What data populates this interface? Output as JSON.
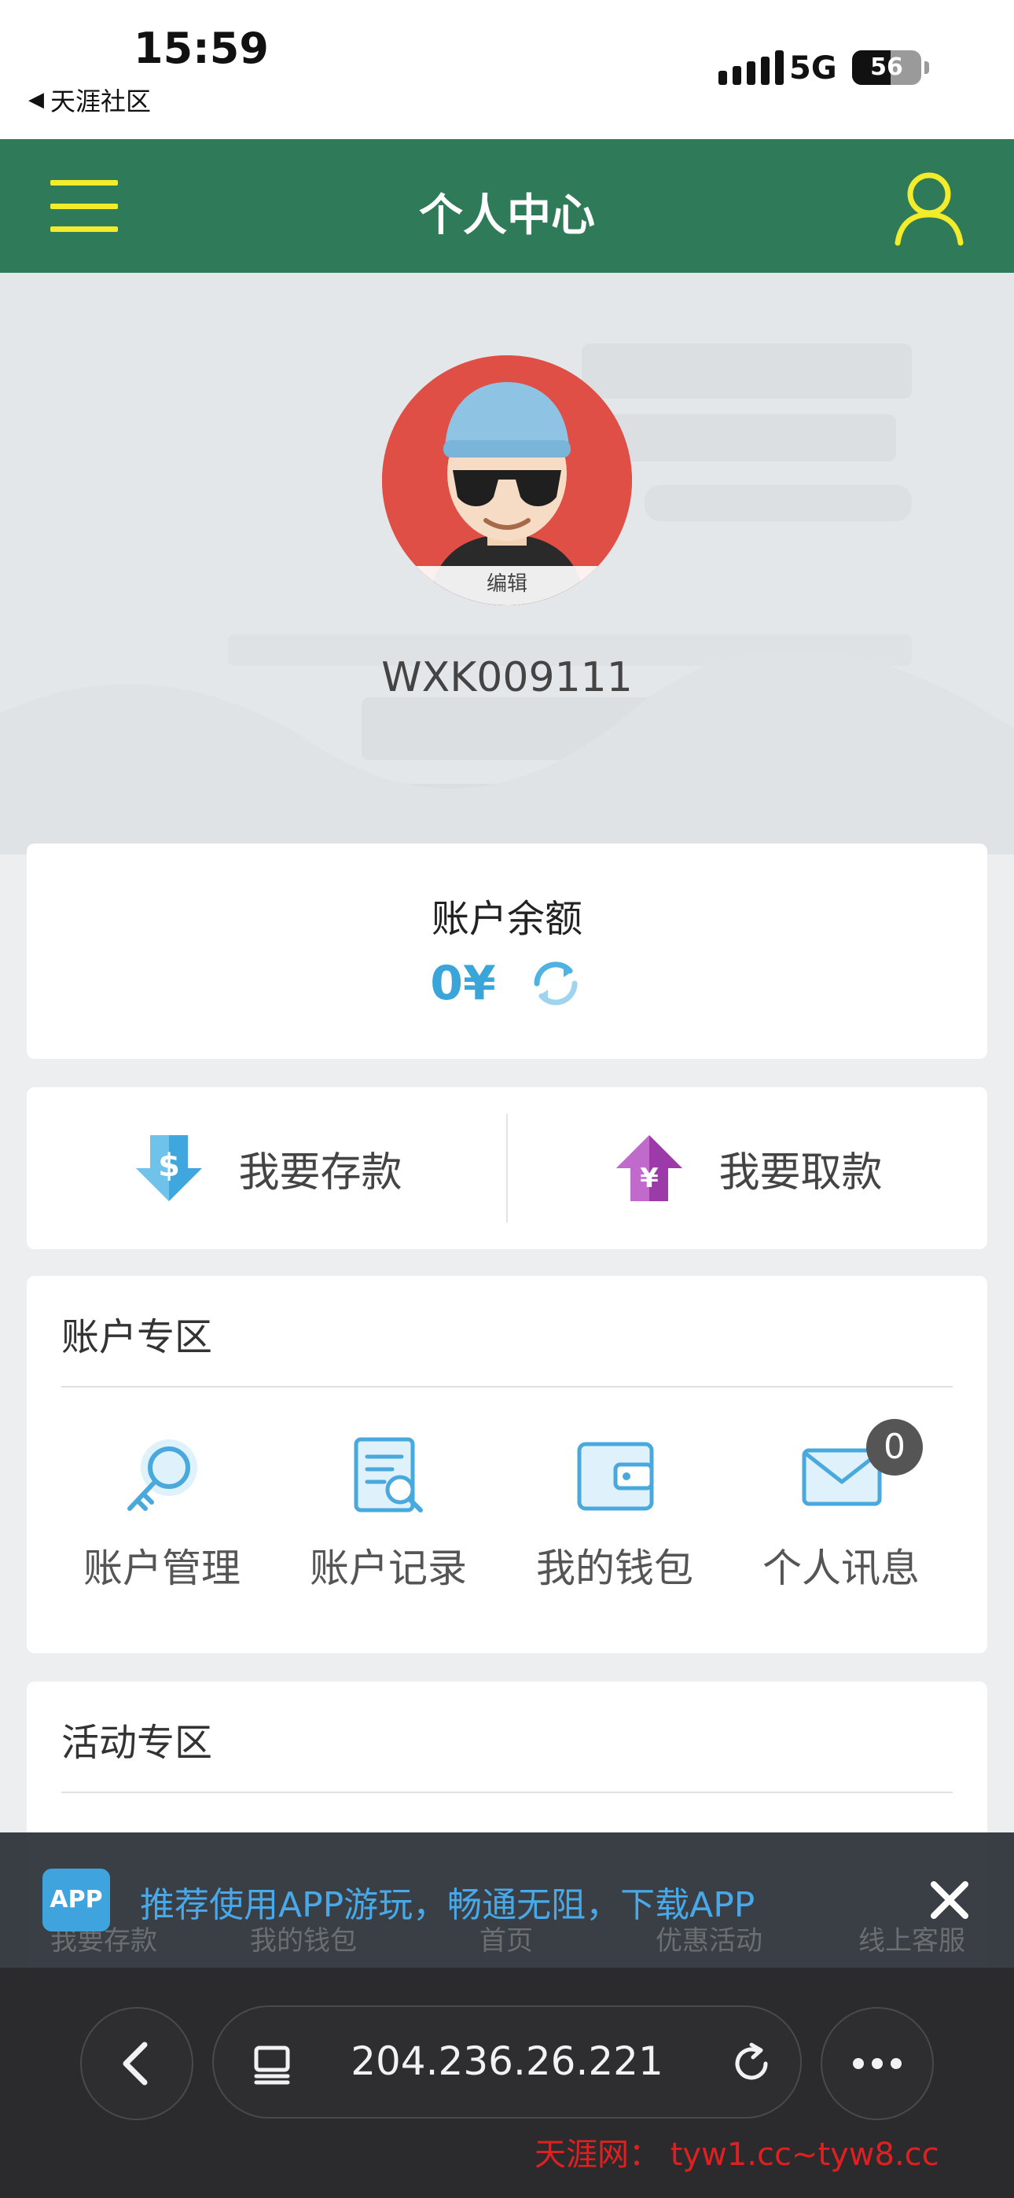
{
  "status_bar": {
    "time": "15:59",
    "back_app": "天涯社区",
    "network": "5G",
    "battery": "56"
  },
  "header": {
    "title": "个人中心"
  },
  "profile": {
    "edit_label": "编辑",
    "username": "WXK009111"
  },
  "balance": {
    "label": "账户余额",
    "value": "0¥"
  },
  "actions": {
    "deposit": "我要存款",
    "withdraw": "我要取款"
  },
  "account_zone": {
    "title": "账户专区",
    "items": [
      {
        "label": "账户管理",
        "icon": "key-icon"
      },
      {
        "label": "账户记录",
        "icon": "record-search-icon"
      },
      {
        "label": "我的钱包",
        "icon": "wallet-icon"
      },
      {
        "label": "个人讯息",
        "icon": "mail-icon",
        "badge": "0"
      }
    ]
  },
  "activity_zone": {
    "title": "活动专区"
  },
  "app_banner": {
    "badge": "APP",
    "text": "推荐使用APP游玩，畅通无阻，下载APP"
  },
  "bottom_nav_faint": [
    "我要存款",
    "我的钱包",
    "首页",
    "优惠活动",
    "线上客服"
  ],
  "browser": {
    "url": "204.236.26.221"
  },
  "watermark": "天涯网： tyw1.cc~tyw8.cc",
  "colors": {
    "header_green": "#2f7a58",
    "menu_yellow": "#f2ec2a",
    "balance_blue": "#3aa5d8",
    "banner_link_blue": "#49a8e8",
    "watermark_red": "#e02020"
  }
}
